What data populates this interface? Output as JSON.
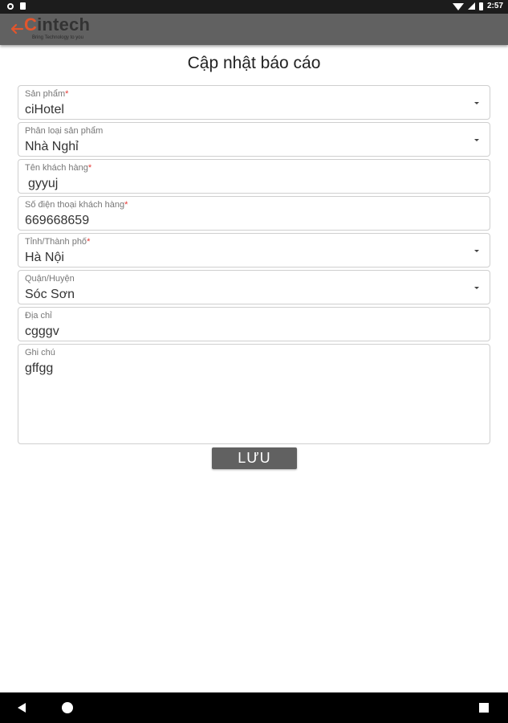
{
  "status_bar": {
    "time": "2:57"
  },
  "app_bar": {
    "logo_c": "C",
    "logo_rest": "intech",
    "logo_tagline": "Bring Technology to you"
  },
  "page": {
    "title": "Cập nhật báo cáo"
  },
  "form": {
    "product": {
      "label": "Sản phẩm",
      "required_mark": "*",
      "value": "ciHotel"
    },
    "product_type": {
      "label": "Phân loại sản phẩm",
      "value": "Nhà Nghỉ"
    },
    "customer_name": {
      "label": "Tên khách hàng",
      "required_mark": "*",
      "value": "gyyuj"
    },
    "customer_phone": {
      "label": "Số điện thoại khách hàng",
      "required_mark": "*",
      "value": "669668659"
    },
    "province": {
      "label": "Tỉnh/Thành phố",
      "required_mark": "*",
      "value": "Hà Nội"
    },
    "district": {
      "label": "Quận/Huyện",
      "value": "Sóc Sơn"
    },
    "address": {
      "label": "Địa chỉ",
      "value": "cgggv"
    },
    "note": {
      "label": "Ghi chú",
      "value": "gffgg"
    }
  },
  "actions": {
    "save_label": "LƯU"
  },
  "colors": {
    "app_bar": "#616161",
    "accent": "#e2552c",
    "required": "#e53935"
  }
}
